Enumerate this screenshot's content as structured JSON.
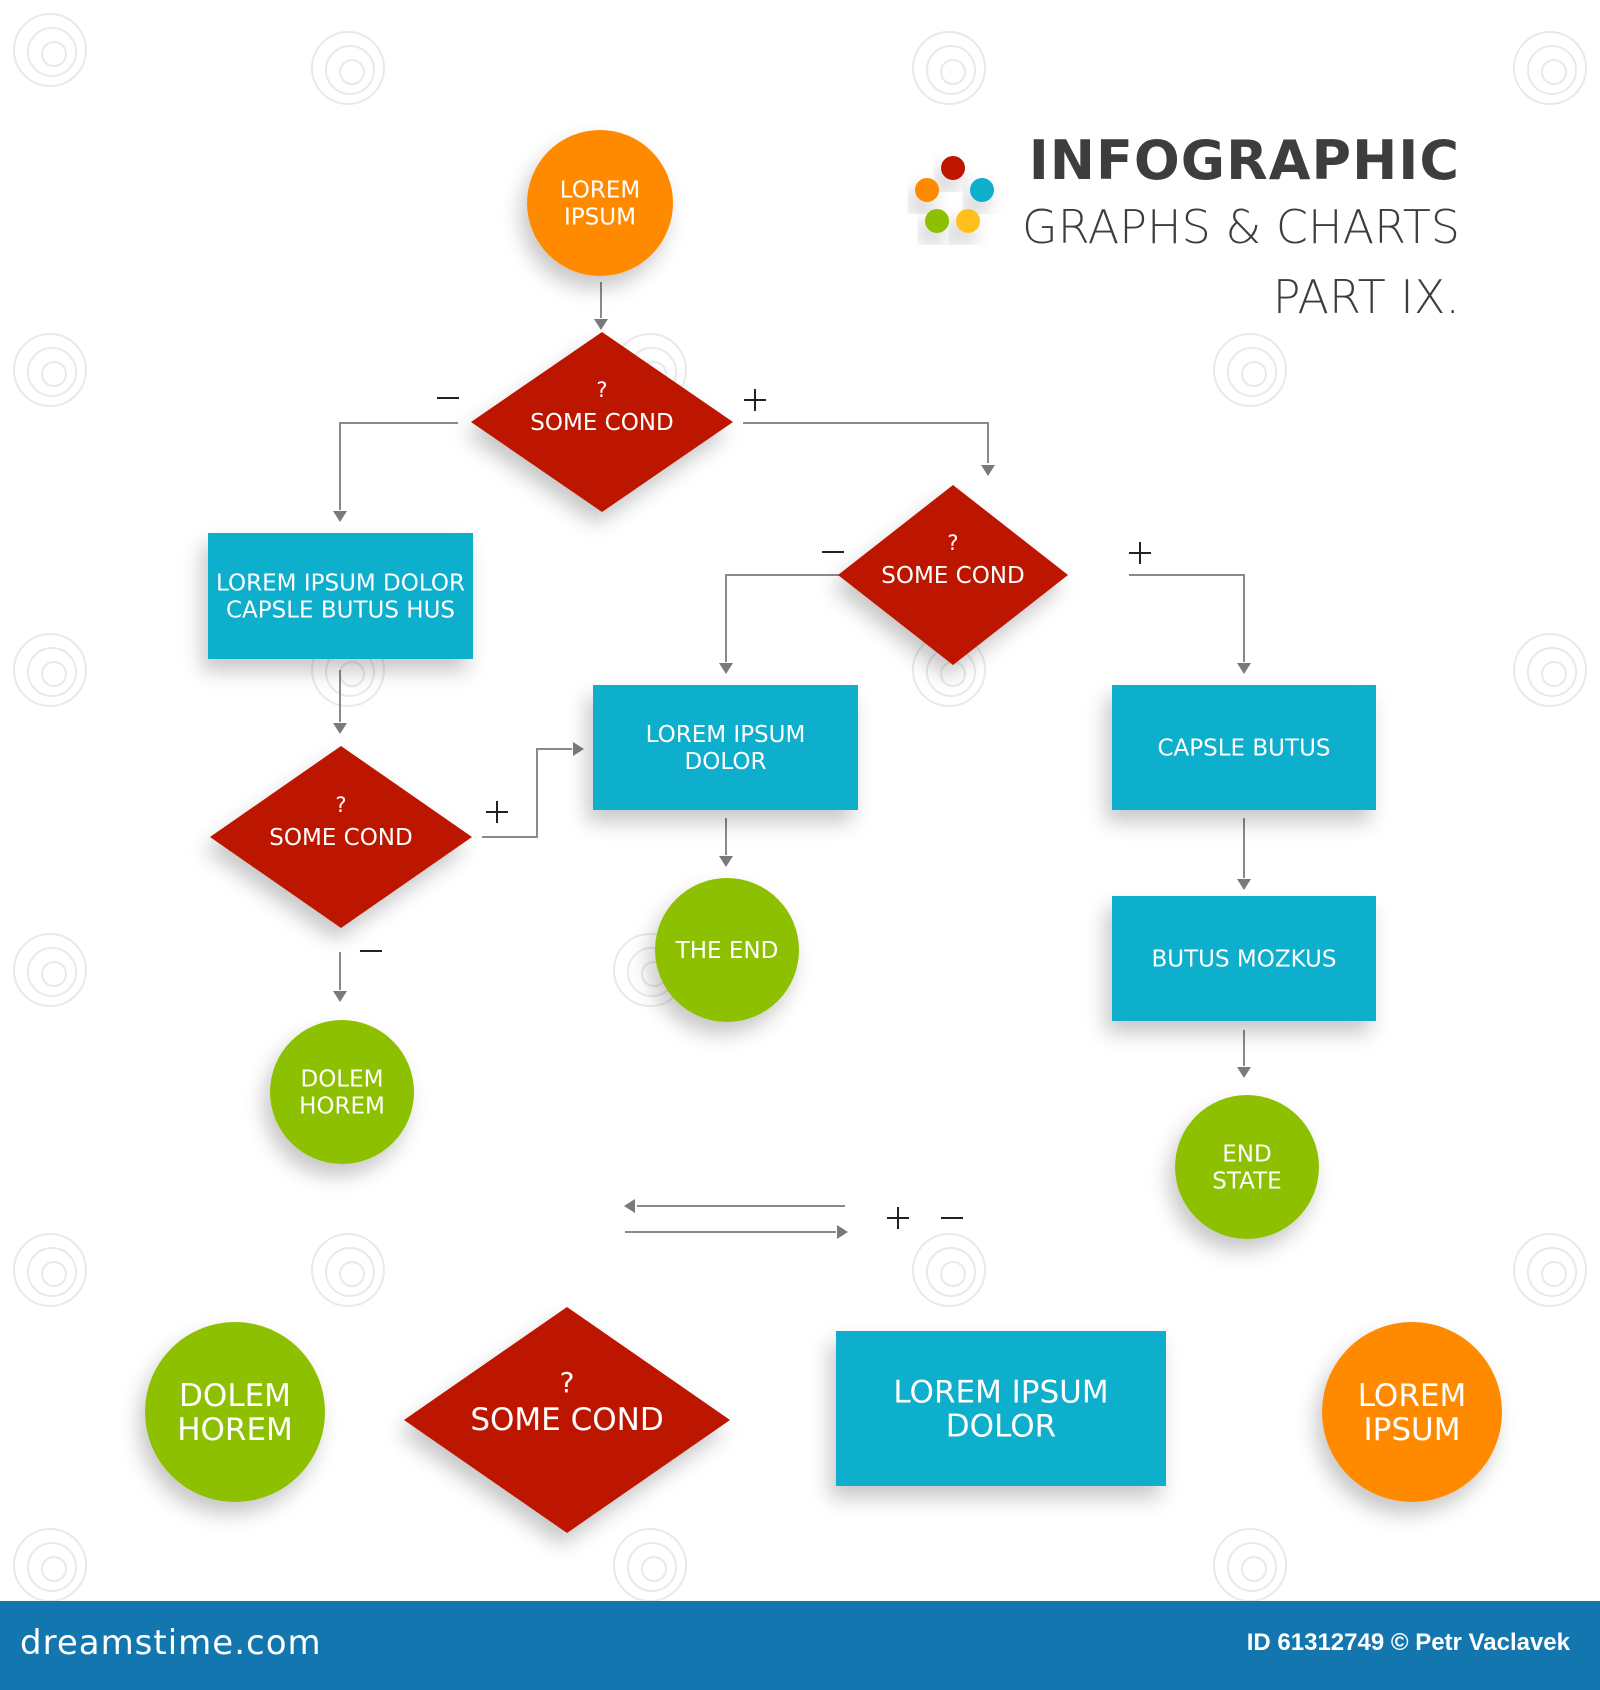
{
  "title": {
    "main": "INFOGRAPHIC",
    "subtitle": "GRAPHS & CHARTS",
    "part": "PART IX."
  },
  "colors": {
    "orange": "#ff8a00",
    "red": "#bd1400",
    "blue": "#0aafcc",
    "green": "#8dc000",
    "yellow": "#ffbf1a",
    "footer": "#1376ae",
    "title_text": "#3d3d3d"
  },
  "logo_dots": [
    "red",
    "orange",
    "blue",
    "green",
    "yellow"
  ],
  "flowchart": {
    "nodes": [
      {
        "id": "start",
        "shape": "circle",
        "color": "orange",
        "lines": [
          "LOREM",
          "IPSUM"
        ]
      },
      {
        "id": "cond1",
        "shape": "diamond",
        "color": "red",
        "question": "?",
        "lines": [
          "SOME COND"
        ]
      },
      {
        "id": "box1",
        "shape": "rect",
        "color": "blue",
        "lines": [
          "LOREM IPSUM DOLOR",
          "CAPSLE BUTUS HUS"
        ]
      },
      {
        "id": "cond2",
        "shape": "diamond",
        "color": "red",
        "question": "?",
        "lines": [
          "SOME COND"
        ]
      },
      {
        "id": "cond3",
        "shape": "diamond",
        "color": "red",
        "question": "?",
        "lines": [
          "SOME COND"
        ]
      },
      {
        "id": "box2",
        "shape": "rect",
        "color": "blue",
        "lines": [
          "LOREM IPSUM",
          "DOLOR"
        ]
      },
      {
        "id": "box3",
        "shape": "rect",
        "color": "blue",
        "lines": [
          "CAPSLE BUTUS"
        ]
      },
      {
        "id": "box4",
        "shape": "rect",
        "color": "blue",
        "lines": [
          "BUTUS MOZKUS"
        ]
      },
      {
        "id": "end1",
        "shape": "circle",
        "color": "green",
        "lines": [
          "DOLEM",
          "HOREM"
        ]
      },
      {
        "id": "end2",
        "shape": "circle",
        "color": "green",
        "lines": [
          "THE END"
        ]
      },
      {
        "id": "end3",
        "shape": "circle",
        "color": "green",
        "lines": [
          "END",
          "STATE"
        ]
      }
    ],
    "edges": [
      {
        "from": "start",
        "to": "cond1",
        "label": ""
      },
      {
        "from": "cond1",
        "to": "box1",
        "label": "−"
      },
      {
        "from": "cond1",
        "to": "cond2",
        "label": "+"
      },
      {
        "from": "box1",
        "to": "cond3",
        "label": ""
      },
      {
        "from": "cond3",
        "to": "box2",
        "label": "+"
      },
      {
        "from": "cond3",
        "to": "end1",
        "label": "−"
      },
      {
        "from": "cond2",
        "to": "box2",
        "label": "−"
      },
      {
        "from": "cond2",
        "to": "box3",
        "label": "+"
      },
      {
        "from": "box2",
        "to": "end2",
        "label": ""
      },
      {
        "from": "box3",
        "to": "box4",
        "label": ""
      },
      {
        "from": "box4",
        "to": "end3",
        "label": ""
      }
    ]
  },
  "legend": {
    "arrows": [
      "left-arrow",
      "right-arrow"
    ],
    "signs": [
      "+",
      "−"
    ],
    "shapes": [
      {
        "shape": "circle",
        "color": "green",
        "lines": [
          "DOLEM",
          "HOREM"
        ]
      },
      {
        "shape": "diamond",
        "color": "red",
        "question": "?",
        "lines": [
          "SOME COND"
        ]
      },
      {
        "shape": "rect",
        "color": "blue",
        "lines": [
          "LOREM IPSUM",
          "DOLOR"
        ]
      },
      {
        "shape": "circle",
        "color": "orange",
        "lines": [
          "LOREM",
          "IPSUM"
        ]
      }
    ]
  },
  "footer": {
    "brand": "dreamstime.com",
    "credit": "ID 61312749 © Petr Vaclavek"
  }
}
